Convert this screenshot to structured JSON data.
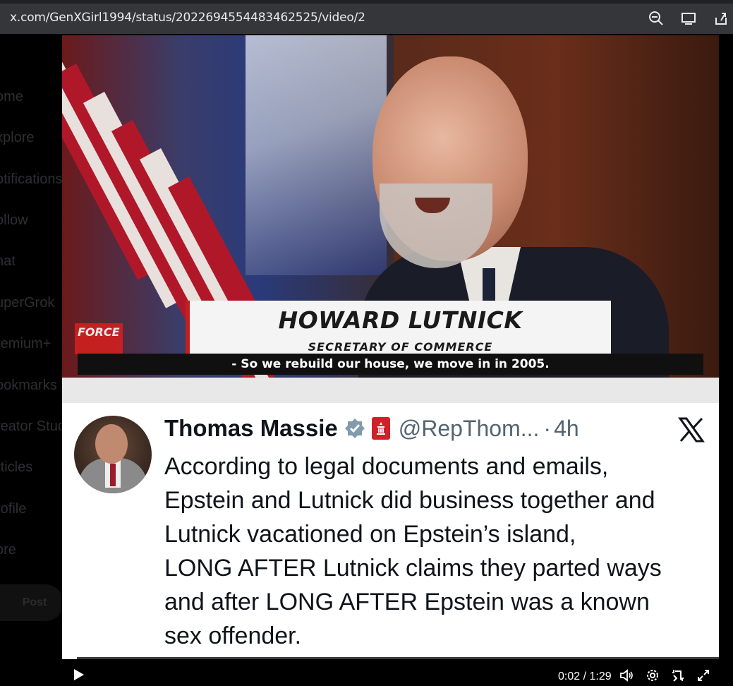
{
  "browser": {
    "url": "x.com/GenXGirl1994/status/2022694554483462525/video/2",
    "icons": [
      "zoom-icon",
      "install-app-icon",
      "share-icon"
    ]
  },
  "sidebar": {
    "items": [
      {
        "label": "ome"
      },
      {
        "label": "xplore"
      },
      {
        "label": "otifications"
      },
      {
        "label": "ollow"
      },
      {
        "label": "hat"
      },
      {
        "label": "uperGrok"
      },
      {
        "label": "remium+"
      },
      {
        "label": "ookmarks"
      },
      {
        "label": "reator Stud"
      },
      {
        "label": "rticles"
      },
      {
        "label": "rofile"
      },
      {
        "label": "ore"
      }
    ],
    "post_label": "Post"
  },
  "video": {
    "lower_third": {
      "name": "HOWARD LUTNICK",
      "title": "SECRETARY OF COMMERCE"
    },
    "logo_text": "FORCE",
    "caption": "- So we rebuild our house, we move in in 2005.",
    "tweet": {
      "author": "Thomas Massie",
      "handle": "@RepThom...",
      "dot": "·",
      "time": "4h",
      "lines": [
        "According to legal documents and emails,",
        "Epstein and Lutnick did business together and",
        "Lutnick vacationed on Epstein’s island,",
        "LONG AFTER Lutnick claims they parted ways",
        "and after LONG AFTER Epstein was a known",
        "sex offender."
      ]
    },
    "controls": {
      "time": "0:02 / 1:29",
      "progress_fraction": 0.023
    }
  },
  "colors": {
    "verified": "#829aab",
    "badge": "#d0202a",
    "caption_bg": "#101010"
  }
}
